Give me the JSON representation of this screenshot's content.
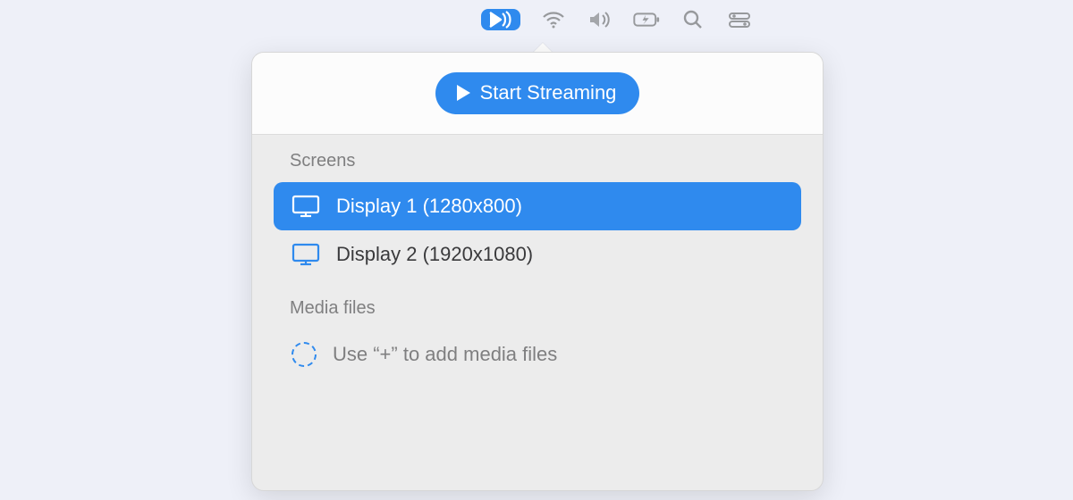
{
  "button": {
    "start_label": "Start Streaming"
  },
  "sections": {
    "screens_label": "Screens",
    "media_label": "Media files"
  },
  "screens": [
    {
      "label": "Display 1 (1280x800)",
      "selected": true
    },
    {
      "label": "Display 2 (1920x1080)",
      "selected": false
    }
  ],
  "media": {
    "placeholder": "Use “+” to add media files"
  }
}
